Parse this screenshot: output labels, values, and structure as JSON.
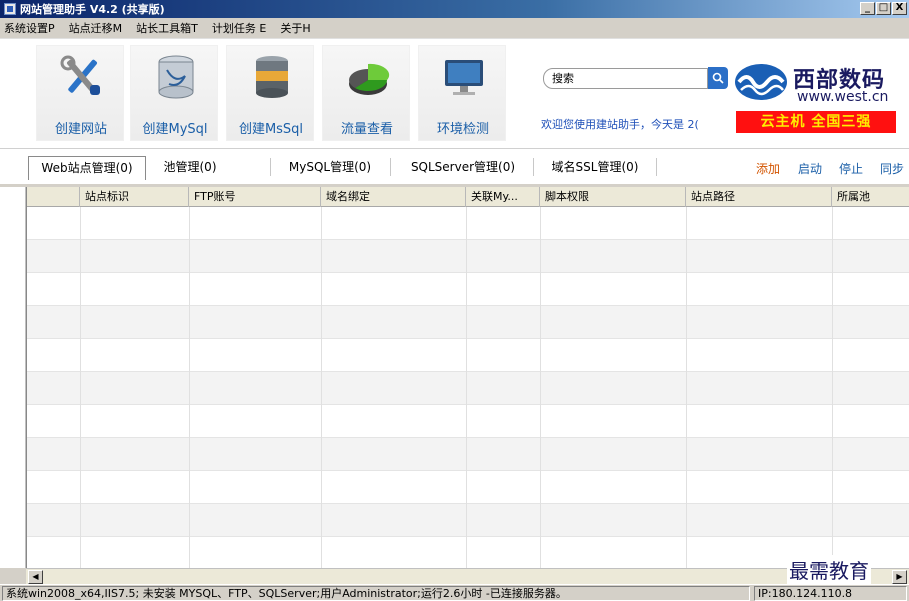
{
  "window": {
    "title": "网站管理助手 V4.2 (共享版)",
    "minimize": "_",
    "maximize": "□",
    "close": "X"
  },
  "menu": [
    "系统设置P",
    "站点迁移M",
    "站长工具箱T",
    "计划任务 E",
    "关于H"
  ],
  "toolbar": {
    "tools": [
      {
        "label": "创建网站",
        "icon": "tools-wrench-icon"
      },
      {
        "label": "创建MySql",
        "icon": "mysql-database-icon"
      },
      {
        "label": "创建MsSql",
        "icon": "mssql-database-icon"
      },
      {
        "label": "流量查看",
        "icon": "traffic-pie-icon"
      },
      {
        "label": "环境检测",
        "icon": "monitor-icon"
      }
    ]
  },
  "search": {
    "placeholder": "搜索"
  },
  "welcome": "欢迎您使用建站助手，今天是 2(",
  "brand": {
    "name_cn": "西部数码",
    "url": "www.west.cn",
    "promo": "云主机  全国三强",
    "promo_bg": "#ff1010",
    "promo_fg": "#ffef00"
  },
  "tabs": [
    "Web站点管理(0)",
    "池管理(0)",
    "MySQL管理(0)",
    "SQLServer管理(0)",
    "域名SSL管理(0)"
  ],
  "actions": [
    "添加",
    "启动",
    "停止",
    "同步"
  ],
  "grid": {
    "columns": [
      "站点标识",
      "FTP账号",
      "域名绑定",
      "关联My...",
      "脚本权限",
      "站点路径",
      "所属池"
    ],
    "row_count": 11
  },
  "watermark": "最需教育",
  "status": {
    "left": "系统win2008_x64,IIS7.5; 未安装 MYSQL、FTP、SQLServer;用户Administrator;运行2.6小时 -已连接服务器。",
    "right": "IP:180.124.110.8"
  },
  "colors": {
    "accent": "#1b5fa8",
    "action": "#c0392b"
  }
}
